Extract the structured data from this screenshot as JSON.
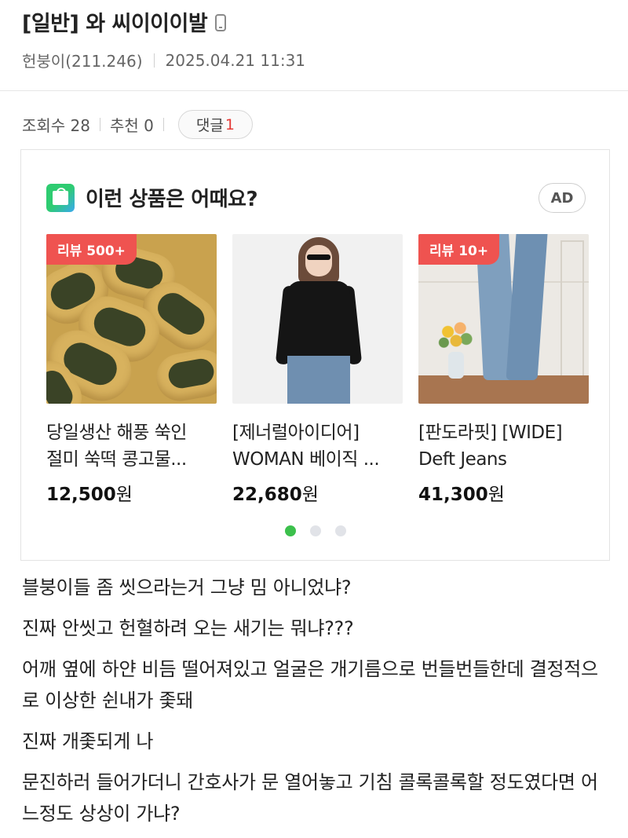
{
  "post": {
    "title": "[일반] 와 씨이이이발",
    "author": "헌붕이(211.246)",
    "date": "2025.04.21 11:31"
  },
  "stats": {
    "views": "조회수 28",
    "recommend": "추천 0",
    "comments_label": "댓글",
    "comments_count": "1"
  },
  "ad": {
    "heading": "이런 상품은 어때요?",
    "badge": "AD",
    "products": [
      {
        "review_badge": "리뷰 500+",
        "name_line1": "당일생산 해풍 쑥인",
        "name_line2": "절미 쑥떡 콩고물...",
        "price": "12,500",
        "currency": "원"
      },
      {
        "review_badge": "",
        "name_line1": "[제너럴아이디어]",
        "name_line2": "WOMAN 베이직 ...",
        "price": "22,680",
        "currency": "원"
      },
      {
        "review_badge": "리뷰 10+",
        "name_line1": "[판도라핏] [WIDE]",
        "name_line2": "Deft Jeans",
        "price": "41,300",
        "currency": "원"
      }
    ],
    "carousel": {
      "pages": 3,
      "active_page": 1
    }
  },
  "body": {
    "paragraphs": [
      "블붕이들 좀 씻으라는거 그냥 밈 아니었냐?",
      "진짜 안씻고 헌혈하려 오는 새기는 뭐냐???",
      "어깨 옆에 하얀 비듬 떨어져있고 얼굴은 개기름으로 번들번들한데 결정적으로 이상한 쉰내가 좇돼",
      "진짜 개좇되게 나",
      "문진하러 들어가더니 간호사가 문 열어놓고 기침 콜록콜록할 정도였다면 어느정도 상상이 가냐?"
    ]
  },
  "colors": {
    "accent_red": "#e53935",
    "badge_red": "#ef5350",
    "carousel_active": "#3cc04c"
  }
}
